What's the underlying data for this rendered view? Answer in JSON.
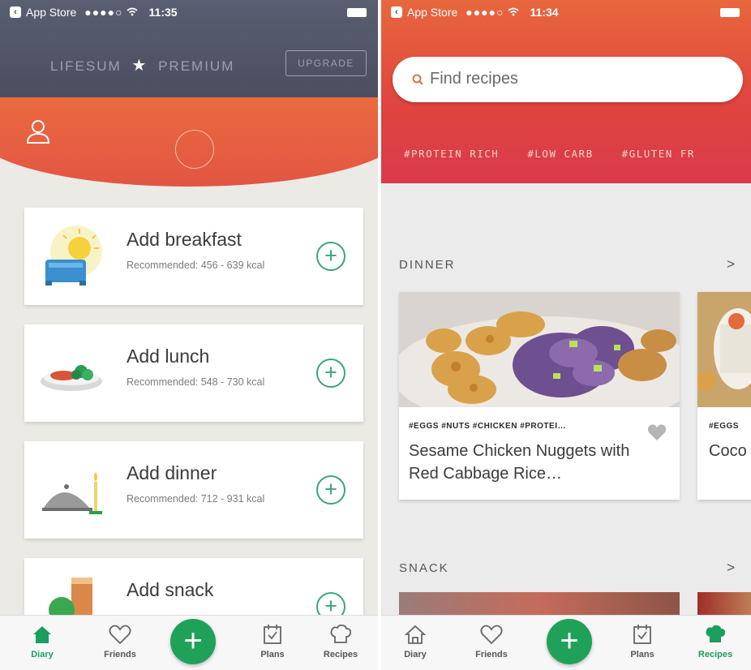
{
  "left": {
    "status": {
      "carrier": "App Store",
      "signal": "●●●●○",
      "time": "11:35"
    },
    "premium": {
      "brand": "LIFESUM",
      "star": "★",
      "label": "PREMIUM",
      "upgrade": "UPGRADE"
    },
    "meals": [
      {
        "title": "Add breakfast",
        "recommended": "Recommended: 456 - 639 kcal"
      },
      {
        "title": "Add lunch",
        "recommended": "Recommended: 548 - 730 kcal"
      },
      {
        "title": "Add dinner",
        "recommended": "Recommended: 712 - 931  kcal"
      },
      {
        "title": "Add snack",
        "recommended": ""
      }
    ],
    "tabs": {
      "diary": "Diary",
      "friends": "Friends",
      "plans": "Plans",
      "recipes": "Recipes"
    },
    "active_tab": "diary"
  },
  "right": {
    "status": {
      "carrier": "App Store",
      "signal": "●●●●○",
      "time": "11:34"
    },
    "search_placeholder": "Find recipes",
    "hashtags": [
      "#PROTEIN RICH",
      "#LOW CARB",
      "#GLUTEN FR"
    ],
    "dinner": {
      "title": "DINNER",
      "chevron": ">",
      "recipes": [
        {
          "tags": "#EGGS #NUTS #CHICKEN #PROTEI…",
          "name": "Sesame Chicken Nuggets with Red Cabbage Rice…"
        },
        {
          "tags": "#EGGS",
          "name": "Coco Carro"
        }
      ]
    },
    "snack": {
      "title": "SNACK",
      "chevron": ">"
    },
    "tabs": {
      "diary": "Diary",
      "friends": "Friends",
      "plans": "Plans",
      "recipes": "Recipes"
    },
    "active_tab": "recipes"
  },
  "colors": {
    "accent_green": "#1b9e5e",
    "header_orange": "#e8673e",
    "header_red": "#da3a4c",
    "premium_slate": "#4a4e5f"
  }
}
